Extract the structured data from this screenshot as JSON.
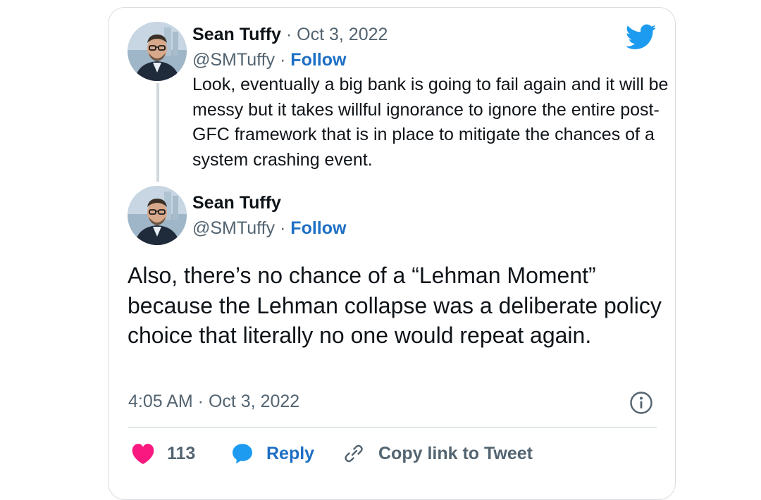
{
  "colors": {
    "twitter_blue": "#1d9bf0",
    "follow_blue": "#1d6fc4",
    "like_red": "#f91880",
    "text_primary": "#0f1419",
    "text_secondary": "#536471"
  },
  "parent_tweet": {
    "author_name": "Sean Tuffy",
    "date": "· Oct 3, 2022",
    "handle": "@SMTuffy ·",
    "follow_label": "Follow",
    "text": "Look, eventually a big bank is going to fail again and it will be messy but it takes willful ignorance to ignore the entire post- GFC framework that is in place to mitigate the chances of a system crashing event."
  },
  "main_tweet": {
    "author_name": "Sean Tuffy",
    "handle": "@SMTuffy ·",
    "follow_label": "Follow",
    "text": "Also, there’s no chance of a “Lehman Moment” because the Lehman collapse was a deliberate policy choice that literally no one would repeat again.",
    "timestamp": "4:05 AM · Oct 3, 2022"
  },
  "actions": {
    "like_count": "113",
    "reply_label": "Reply",
    "copy_link_label": "Copy link to Tweet"
  },
  "icons": [
    "twitter-bird-icon",
    "info-icon",
    "heart-icon",
    "reply-bubble-icon",
    "link-icon"
  ]
}
